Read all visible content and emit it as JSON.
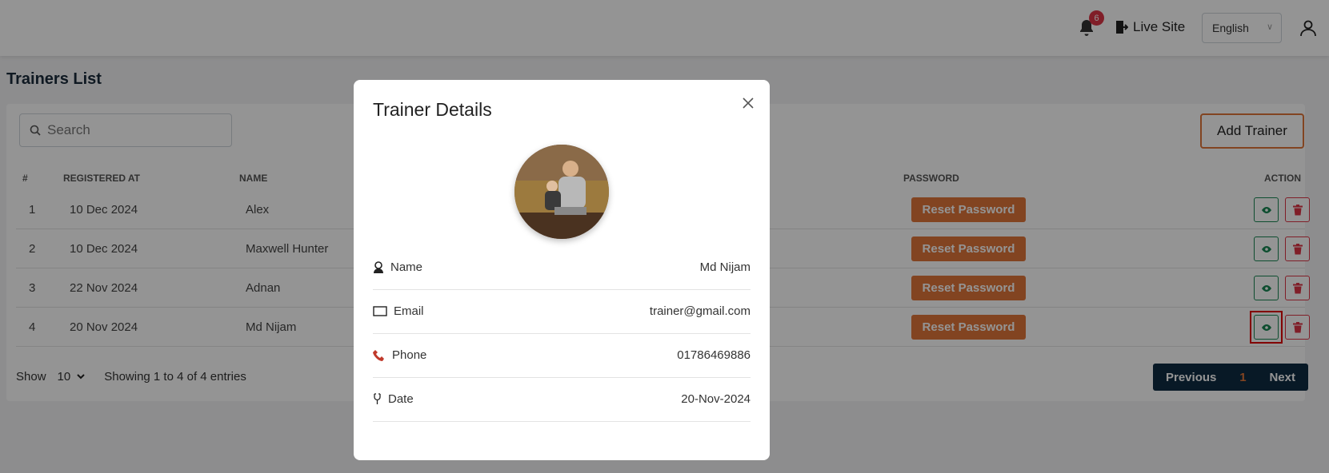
{
  "header": {
    "notification_count": "6",
    "live_site_label": "Live Site",
    "language_selected": "English"
  },
  "page": {
    "title": "Trainers List",
    "search_placeholder": "Search",
    "add_button_label": "Add Trainer"
  },
  "table": {
    "headers": {
      "index": "#",
      "registered_at": "REGISTERED AT",
      "name": "NAME",
      "password": "PASSWORD",
      "action": "ACTION"
    },
    "reset_label": "Reset Password",
    "rows": [
      {
        "index": "1",
        "registered_at": "10 Dec 2024",
        "name": "Alex"
      },
      {
        "index": "2",
        "registered_at": "10 Dec 2024",
        "name": "Maxwell Hunter"
      },
      {
        "index": "3",
        "registered_at": "22 Nov 2024",
        "name": "Adnan"
      },
      {
        "index": "4",
        "registered_at": "20 Nov 2024",
        "name": "Md Nijam"
      }
    ]
  },
  "footer": {
    "show_label": "Show",
    "page_length": "10",
    "entries_info": "Showing 1 to 4 of 4 entries",
    "prev_label": "Previous",
    "current_page": "1",
    "next_label": "Next"
  },
  "modal": {
    "title": "Trainer Details",
    "fields": [
      {
        "label": "Name",
        "value": "Md Nijam",
        "icon": "user-icon"
      },
      {
        "label": "Email",
        "value": "trainer@gmail.com",
        "icon": "envelope-icon"
      },
      {
        "label": "Phone",
        "value": "01786469886",
        "icon": "phone-icon"
      },
      {
        "label": "Date",
        "value": "20-Nov-2024",
        "icon": "date-icon"
      }
    ]
  },
  "colors": {
    "accent": "#e0763a",
    "dark_navy": "#0f2c42",
    "success": "#198754",
    "danger": "#dc3545"
  }
}
